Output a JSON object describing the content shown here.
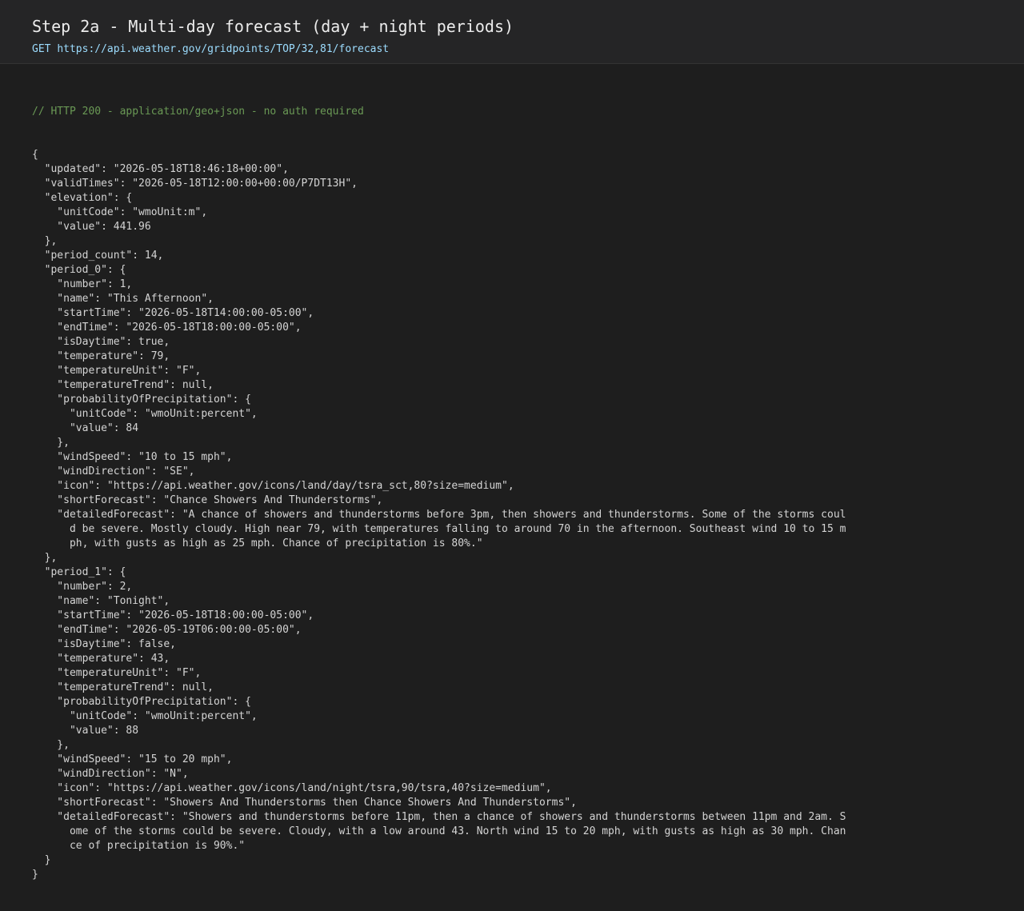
{
  "header": {
    "title": "Step 2a - Multi-day forecast (day + night periods)",
    "method": "GET",
    "url": "https://api.weather.gov/gridpoints/TOP/32,81/forecast"
  },
  "response": {
    "status_comment": "// HTTP 200 - application/geo+json - no auth required",
    "lines": [
      "{",
      "  \"updated\": \"2026-05-18T18:46:18+00:00\",",
      "  \"validTimes\": \"2026-05-18T12:00:00+00:00/P7DT13H\",",
      "  \"elevation\": {",
      "    \"unitCode\": \"wmoUnit:m\",",
      "    \"value\": 441.96",
      "  },",
      "  \"period_count\": 14,",
      "  \"period_0\": {",
      "    \"number\": 1,",
      "    \"name\": \"This Afternoon\",",
      "    \"startTime\": \"2026-05-18T14:00:00-05:00\",",
      "    \"endTime\": \"2026-05-18T18:00:00-05:00\",",
      "    \"isDaytime\": true,",
      "    \"temperature\": 79,",
      "    \"temperatureUnit\": \"F\",",
      "    \"temperatureTrend\": null,",
      "    \"probabilityOfPrecipitation\": {",
      "      \"unitCode\": \"wmoUnit:percent\",",
      "      \"value\": 84",
      "    },",
      "    \"windSpeed\": \"10 to 15 mph\",",
      "    \"windDirection\": \"SE\",",
      "    \"icon\": \"https://api.weather.gov/icons/land/day/tsra_sct,80?size=medium\",",
      "    \"shortForecast\": \"Chance Showers And Thunderstorms\",",
      "    \"detailedForecast\": \"A chance of showers and thunderstorms before 3pm, then showers and thunderstorms. Some of the storms coul",
      "      d be severe. Mostly cloudy. High near 79, with temperatures falling to around 70 in the afternoon. Southeast wind 10 to 15 m",
      "      ph, with gusts as high as 25 mph. Chance of precipitation is 80%.\"",
      "  },",
      "  \"period_1\": {",
      "    \"number\": 2,",
      "    \"name\": \"Tonight\",",
      "    \"startTime\": \"2026-05-18T18:00:00-05:00\",",
      "    \"endTime\": \"2026-05-19T06:00:00-05:00\",",
      "    \"isDaytime\": false,",
      "    \"temperature\": 43,",
      "    \"temperatureUnit\": \"F\",",
      "    \"temperatureTrend\": null,",
      "    \"probabilityOfPrecipitation\": {",
      "      \"unitCode\": \"wmoUnit:percent\",",
      "      \"value\": 88",
      "    },",
      "    \"windSpeed\": \"15 to 20 mph\",",
      "    \"windDirection\": \"N\",",
      "    \"icon\": \"https://api.weather.gov/icons/land/night/tsra,90/tsra,40?size=medium\",",
      "    \"shortForecast\": \"Showers And Thunderstorms then Chance Showers And Thunderstorms\",",
      "    \"detailedForecast\": \"Showers and thunderstorms before 11pm, then a chance of showers and thunderstorms between 11pm and 2am. S",
      "      ome of the storms could be severe. Cloudy, with a low around 43. North wind 15 to 20 mph, with gusts as high as 30 mph. Chan",
      "      ce of precipitation is 90%.\"",
      "  }",
      "}"
    ]
  },
  "colors": {
    "background": "#1e1e1e",
    "header_background": "#252526",
    "title": "#ececec",
    "url": "#9cdcfe",
    "comment": "#6a9955",
    "code_text": "#d4d4d4"
  }
}
